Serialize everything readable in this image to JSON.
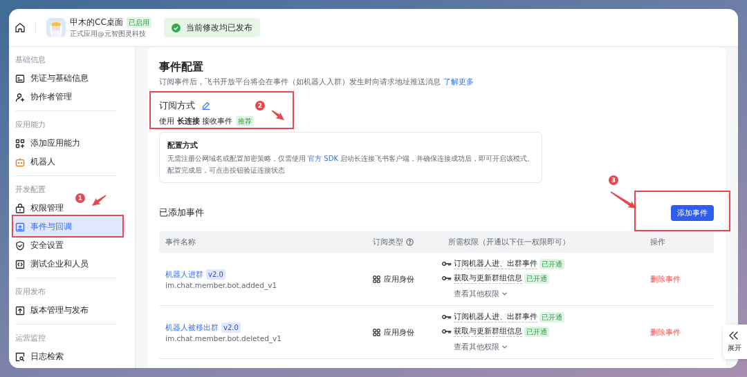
{
  "header": {
    "app_name": "甲木的CC桌面",
    "status_tag": "已启用",
    "subtitle": "正式应用@元智图灵科技",
    "toast": "当前修改均已发布"
  },
  "sidebar": {
    "groups": [
      {
        "label": "基础信息",
        "items": [
          {
            "label": "凭证与基础信息",
            "selected": false
          },
          {
            "label": "协作者管理",
            "selected": false
          }
        ]
      },
      {
        "label": "应用能力",
        "items": [
          {
            "label": "添加应用能力",
            "selected": false
          },
          {
            "label": "机器人",
            "selected": false
          }
        ]
      },
      {
        "label": "开发配置",
        "items": [
          {
            "label": "权限管理",
            "selected": false
          },
          {
            "label": "事件与回调",
            "selected": true
          },
          {
            "label": "安全设置",
            "selected": false
          },
          {
            "label": "测试企业和人员",
            "selected": false
          }
        ]
      },
      {
        "label": "应用发布",
        "items": [
          {
            "label": "版本管理与发布",
            "selected": false
          }
        ]
      },
      {
        "label": "运营监控",
        "items": [
          {
            "label": "日志检索",
            "selected": false
          }
        ]
      }
    ]
  },
  "page": {
    "title": "事件配置",
    "description": "订阅事件后，飞书开放平台将会在事件（如机器人入群）发生时向请求地址推送消息",
    "learn_more_link": "了解更多",
    "subscription": {
      "heading": "订阅方式",
      "mode_text": "使用 **长连接** 接收事件",
      "badge": "推荐"
    },
    "config_box": {
      "title": "配置方式",
      "intro": "无需注册公网域名或配置加密策略，仅需使用",
      "link": "官方 SDK",
      "rest": "启动长连接飞书客户端，并确保连接成功后，即可开启该模式。",
      "note": "配置完成后，可点击按钮验证连接状态"
    },
    "events": {
      "heading": "已添加事件",
      "add_button": "添加事件",
      "columns": [
        {
          "label": "事件名称",
          "kind": "plain"
        },
        {
          "label": "订阅类型",
          "kind": "help"
        },
        {
          "label": "所需权限（开通以下任一权限即可）",
          "kind": "plain"
        },
        {
          "label": "操作",
          "kind": "plain"
        }
      ],
      "rows": [
        {
          "name": "机器人进群",
          "version": "v2.0",
          "event_key": "im.chat.member.bot.added_v1",
          "subscription_type": "应用身份",
          "permissions": [
            {
              "name": "订阅机器人进、出群事件",
              "status": "已开通"
            },
            {
              "name": "获取与更新群组信息",
              "status": "已开通"
            }
          ],
          "more_link": "查看其他权限",
          "action": "删除事件"
        },
        {
          "name": "机器人被移出群",
          "version": "v2.0",
          "event_key": "im.chat.member.bot.deleted_v1",
          "subscription_type": "应用身份",
          "permissions": [
            {
              "name": "订阅机器人进、出群事件",
              "status": "已开通"
            },
            {
              "name": "获取与更新群组信息",
              "status": "已开通"
            }
          ],
          "more_link": "查看其他权限",
          "action": "删除事件"
        }
      ]
    }
  },
  "expand_tab": {
    "label": "展开"
  },
  "annotations": [
    {
      "number": "1"
    },
    {
      "number": "2"
    },
    {
      "number": "3"
    }
  ]
}
